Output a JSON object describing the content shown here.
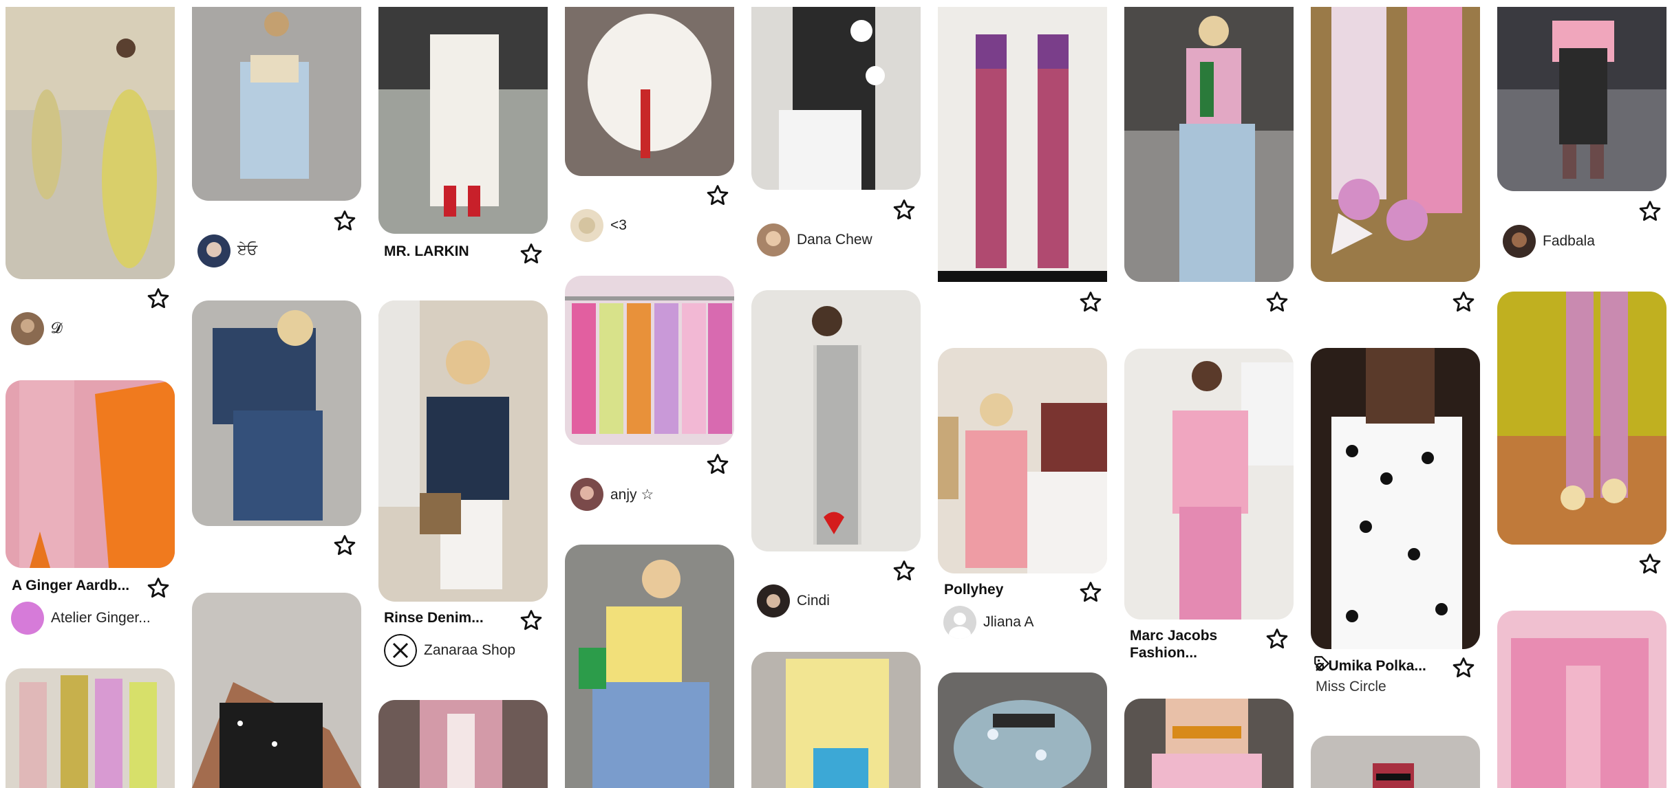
{
  "pins": [
    {
      "creator": "𝓓"
    },
    {
      "title": "A Ginger Aardb...",
      "creator": "Atelier Ginger..."
    },
    {
      "creator": "ਏਓ"
    },
    {
      "title": "MR. LARKIN"
    },
    {
      "title": "Rinse Denim...",
      "creator": "Zanaraa Shop"
    },
    {
      "creator": "<3"
    },
    {
      "creator": "anjy ☆"
    },
    {
      "creator": "Dana Chew"
    },
    {
      "creator": "Cindi"
    },
    {
      "title": "Pollyhey",
      "creator": "Jliana A"
    },
    {
      "title": "Marc Jacobs",
      "title2": "Fashion..."
    },
    {
      "title": "⌀ Umika Polka...",
      "creator": "Miss Circle"
    },
    {
      "creator": "Fadbala"
    }
  ],
  "icons": {
    "save": "star-outline-icon",
    "tag": "tag-icon"
  },
  "colors": {
    "background": "#ffffff",
    "text": "#111111",
    "icon": "#111111"
  }
}
